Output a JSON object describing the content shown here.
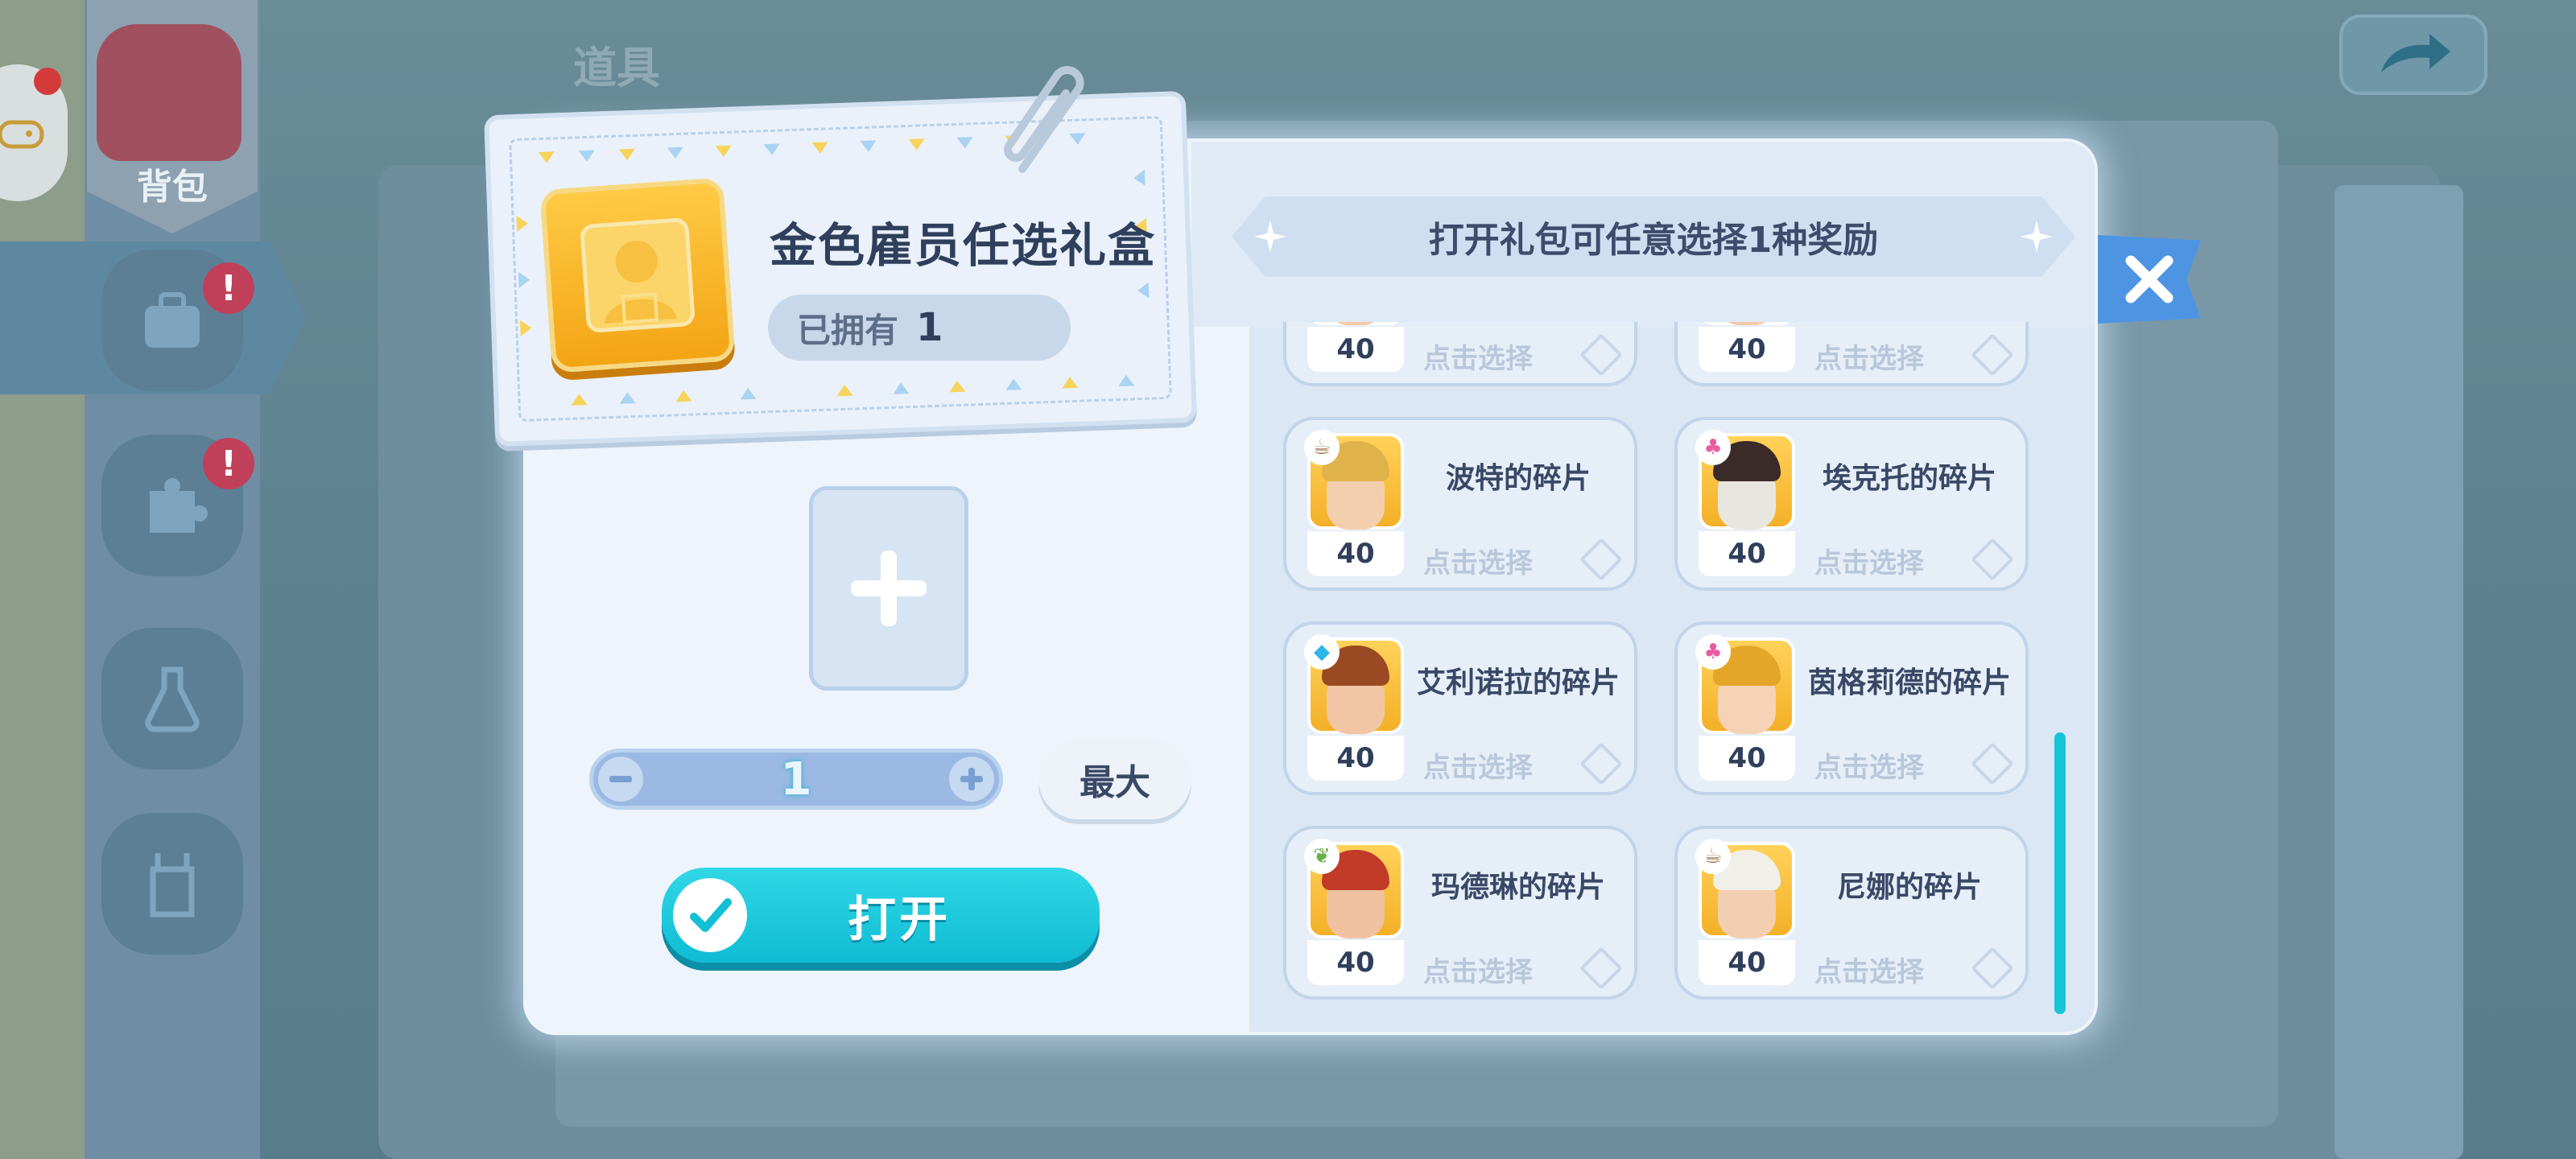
{
  "background": {
    "section_title": "道具",
    "bag_tab_label": "背包",
    "side_badge_mark": "!"
  },
  "item": {
    "name": "金色雇员任选礼盒",
    "owned_label": "已拥有",
    "owned_count": "1"
  },
  "controls": {
    "quantity": "1",
    "max_label": "最大",
    "open_label": "打开"
  },
  "header": {
    "ribbon_text": "打开礼包可任意选择1种奖励"
  },
  "rewards": [
    {
      "name": "",
      "count": "40",
      "select_label": "点击选择",
      "tag": "none",
      "hair": "#c9843a",
      "face": "#f3c9a8"
    },
    {
      "name": "",
      "count": "40",
      "select_label": "点击选择",
      "tag": "none",
      "hair": "#c9843a",
      "face": "#f3c9a8"
    },
    {
      "name": "波特的碎片",
      "count": "40",
      "select_label": "点击选择",
      "tag": "coffee",
      "tag_color": "#9c7350",
      "hair": "#e0b24a",
      "face": "#f4cfae"
    },
    {
      "name": "埃克托的碎片",
      "count": "40",
      "select_label": "点击选择",
      "tag": "cupcake",
      "tag_color": "#e85ca0",
      "hair": "#3a2b2a",
      "face": "#e9e6e0"
    },
    {
      "name": "艾利诺拉的碎片",
      "count": "40",
      "select_label": "点击选择",
      "tag": "drink",
      "tag_color": "#2db6e6",
      "hair": "#9a4a22",
      "face": "#f2c6a4"
    },
    {
      "name": "茵格莉德的碎片",
      "count": "40",
      "select_label": "点击选择",
      "tag": "cupcake",
      "tag_color": "#e85ca0",
      "hair": "#e3a629",
      "face": "#f6d2b6"
    },
    {
      "name": "玛德琳的碎片",
      "count": "40",
      "select_label": "点击选择",
      "tag": "leaf",
      "tag_color": "#6ab04a",
      "hair": "#c23a28",
      "face": "#f0c2a0"
    },
    {
      "name": "尼娜的碎片",
      "count": "40",
      "select_label": "点击选择",
      "tag": "coffee",
      "tag_color": "#9c7350",
      "hair": "#f0efe8",
      "face": "#f3cfb2"
    }
  ]
}
